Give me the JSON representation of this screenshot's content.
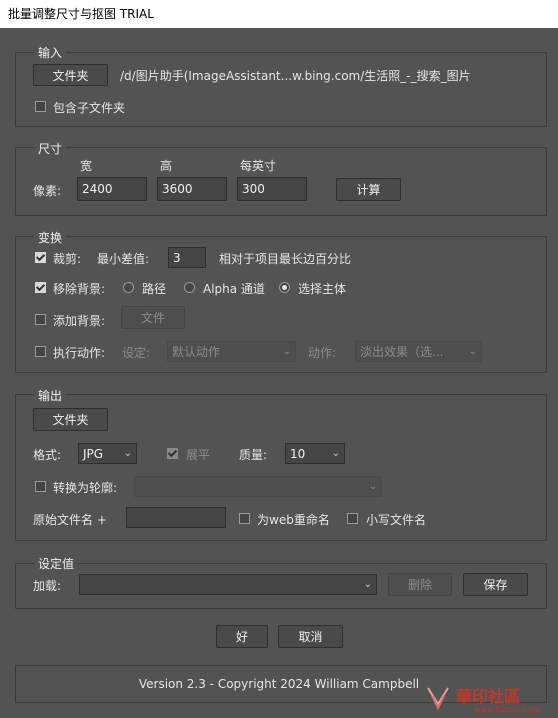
{
  "window": {
    "title": "批量调整尺寸与抠图 TRIAL"
  },
  "input_group": {
    "legend": "输入",
    "folder_button": "文件夹",
    "path": "/d/图片助手(ImageAssistant...w.bing.com/生活照_-_搜索_图片",
    "include_subfolders": "包含子文件夹"
  },
  "size_group": {
    "legend": "尺寸",
    "width_label": "宽",
    "height_label": "高",
    "ppi_label": "每英寸",
    "pixels_label": "像素:",
    "width_value": "2400",
    "height_value": "3600",
    "ppi_value": "300",
    "calc_button": "计算"
  },
  "transform_group": {
    "legend": "变换",
    "crop_label": "裁剪:",
    "min_diff_label": "最小差值:",
    "min_diff_value": "3",
    "crop_hint": "相对于项目最长边百分比",
    "remove_bg_label": "移除背景:",
    "radio_path": "路径",
    "radio_alpha": "Alpha 通道",
    "radio_subject": "选择主体",
    "add_bg_label": "添加背景:",
    "add_bg_button": "文件",
    "action_label": "执行动作:",
    "set_label": "设定:",
    "set_value": "默认动作",
    "act_label": "动作:",
    "act_value": "淡出效果（选..."
  },
  "output_group": {
    "legend": "输出",
    "folder_button": "文件夹",
    "format_label": "格式:",
    "format_value": "JPG",
    "flatten_label": "展平",
    "quality_label": "质量:",
    "quality_value": "10",
    "convert_profile_label": "转换为轮廓:",
    "profile_value": "",
    "orig_name_label": "原始文件名 +",
    "suffix_value": "",
    "web_rename_label": "为web重命名",
    "lowercase_label": "小写文件名"
  },
  "settings_group": {
    "legend": "设定值",
    "load_label": "加载:",
    "preset_value": "",
    "delete_button": "删除",
    "save_button": "保存"
  },
  "footer": {
    "ok_button": "好",
    "cancel_button": "取消",
    "version": "Version 2.3 - Copyright 2024 William Campbell"
  },
  "watermark": {
    "text": "華印社區",
    "url": "www.52cnp.com"
  },
  "colors": {
    "background": "#535353",
    "border": "#3c3c3c",
    "field": "#454545"
  }
}
